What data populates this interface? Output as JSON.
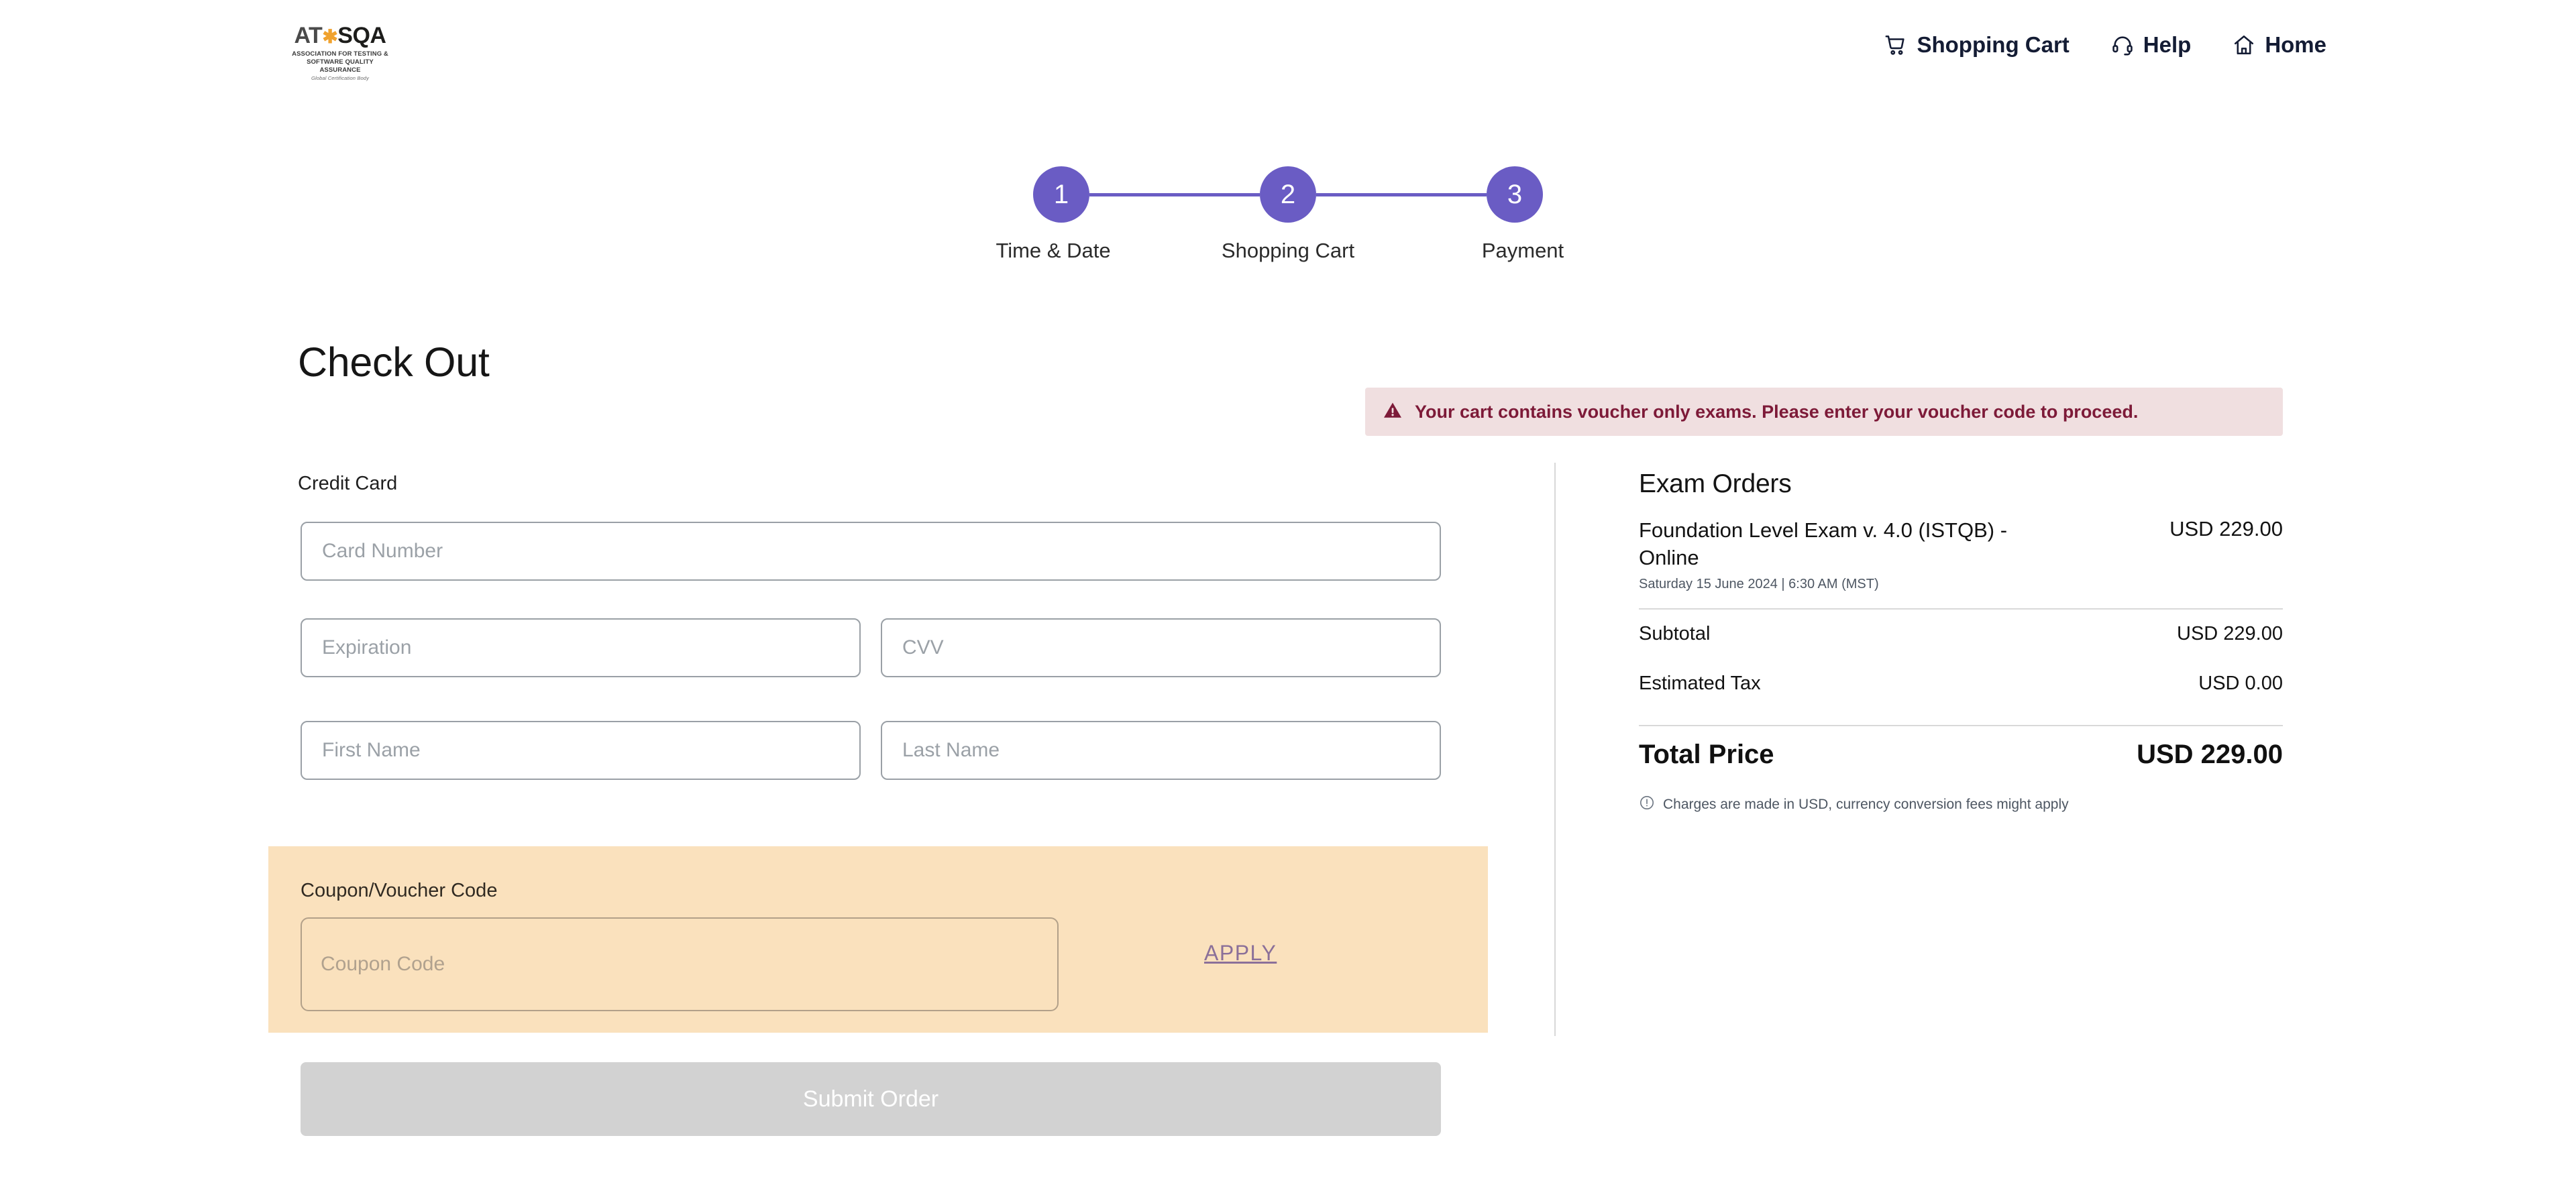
{
  "header": {
    "logo": {
      "main_left": "AT",
      "main_star": "✱",
      "main_right": "SQA",
      "subtitle_line1": "ASSOCIATION FOR TESTING &",
      "subtitle_line2": "SOFTWARE QUALITY ASSURANCE",
      "tagline": "Global Certification Body"
    },
    "nav": [
      {
        "label": "Shopping Cart",
        "icon": "shopping-cart-icon"
      },
      {
        "label": "Help",
        "icon": "headset-icon"
      },
      {
        "label": "Home",
        "icon": "home-icon"
      }
    ]
  },
  "stepper": {
    "steps": [
      {
        "number": "1",
        "label": "Time & Date"
      },
      {
        "number": "2",
        "label": "Shopping Cart"
      },
      {
        "number": "3",
        "label": "Payment"
      }
    ],
    "accent_color": "#6a5cc4"
  },
  "main": {
    "page_title": "Check Out",
    "alert": {
      "icon": "warning-triangle-icon",
      "message": "Your cart contains voucher only exams. Please enter your voucher code to proceed.",
      "background_color": "#f0dfe0",
      "text_color": "#7d1a38"
    },
    "payment_form": {
      "section_label": "Credit Card",
      "fields": [
        {
          "name": "card-number",
          "placeholder": "Card Number",
          "value": ""
        },
        {
          "name": "expiration",
          "placeholder": "Expiration",
          "value": ""
        },
        {
          "name": "cvv",
          "placeholder": "CVV",
          "value": ""
        },
        {
          "name": "first-name",
          "placeholder": "First Name",
          "value": ""
        },
        {
          "name": "last-name",
          "placeholder": "Last Name",
          "value": ""
        }
      ]
    },
    "coupon": {
      "label": "Coupon/Voucher Code",
      "placeholder": "Coupon Code",
      "value": "",
      "apply_label": "APPLY",
      "background_color": "#fae1bd",
      "apply_color": "#8b7099"
    },
    "submit": {
      "label": "Submit Order",
      "disabled": true,
      "background_color": "#d2d2d2"
    }
  },
  "summary": {
    "title": "Exam Orders",
    "items": [
      {
        "name": "Foundation Level Exam v. 4.0 (ISTQB) - Online",
        "schedule": "Saturday 15 June 2024 | 6:30 AM (MST)",
        "price": "USD 229.00"
      }
    ],
    "lines": [
      {
        "label": "Subtotal",
        "value": "USD 229.00"
      },
      {
        "label": "Estimated Tax",
        "value": "USD 0.00"
      }
    ],
    "total": {
      "label": "Total Price",
      "value": "USD 229.00"
    },
    "note": {
      "icon": "info-circle-icon",
      "text": "Charges are made in USD, currency conversion fees might apply"
    }
  }
}
